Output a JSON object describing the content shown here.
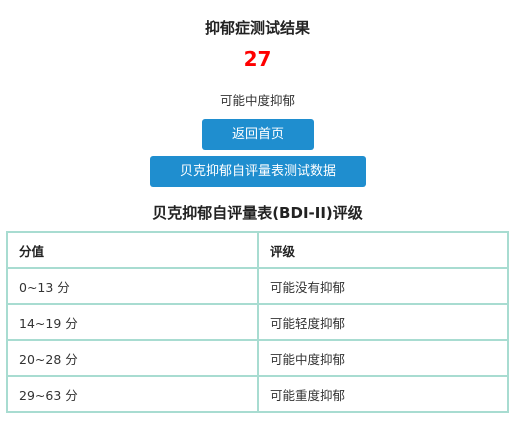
{
  "result": {
    "title": "抑郁症测试结果",
    "score": "27",
    "level_text": "可能中度抑郁"
  },
  "buttons": {
    "home_label": "返回首页",
    "data_label": "贝克抑郁自评量表测试数据"
  },
  "rating_table": {
    "title": "贝克抑郁自评量表(BDI-II)评级",
    "headers": [
      "分值",
      "评级"
    ],
    "rows": [
      [
        "0~13 分",
        "可能没有抑郁"
      ],
      [
        "14~19 分",
        "可能轻度抑郁"
      ],
      [
        "20~28 分",
        "可能中度抑郁"
      ],
      [
        "29~63 分",
        "可能重度抑郁"
      ]
    ]
  },
  "colors": {
    "score": "#ff0000",
    "button_bg": "#1f8ecf",
    "table_border": "#a8dcd1"
  }
}
